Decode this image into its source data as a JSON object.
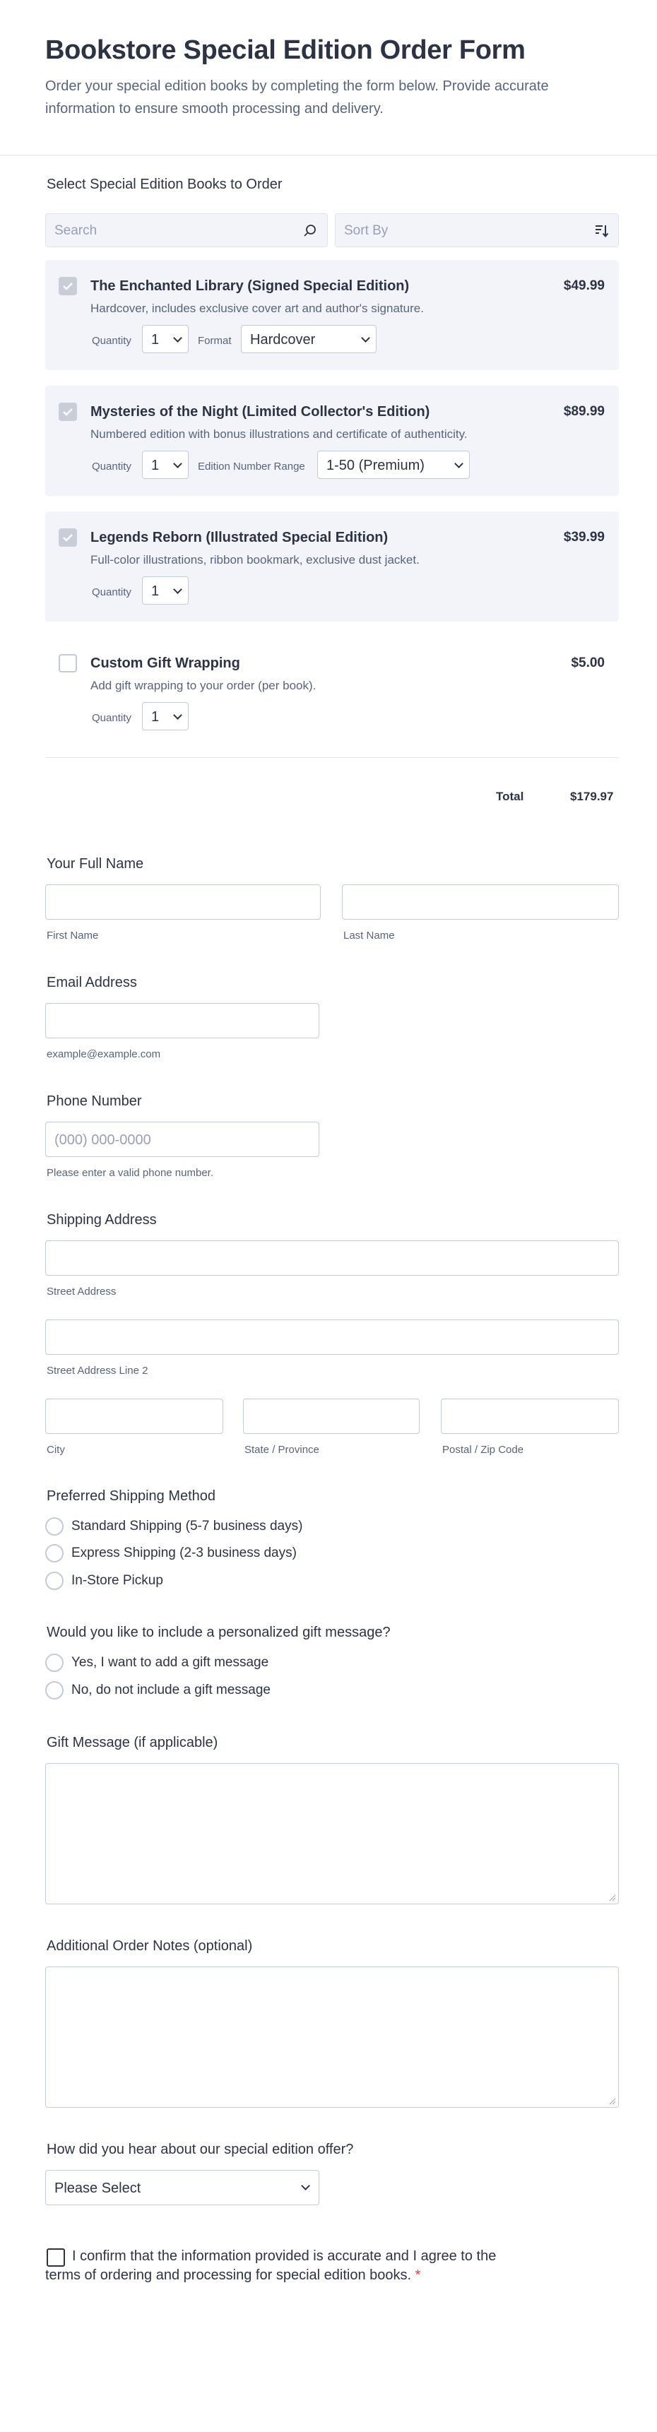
{
  "header": {
    "title": "Bookstore Special Edition Order Form",
    "subtitle": "Order your special edition books by completing the form below. Provide accurate information to ensure smooth processing and delivery."
  },
  "products": {
    "section_label": "Select Special Edition Books to Order",
    "search_placeholder": "Search",
    "sort_placeholder": "Sort By",
    "items": [
      {
        "name": "The Enchanted Library (Signed Special Edition)",
        "desc": "Hardcover, includes exclusive cover art and author's signature.",
        "price": "$49.99",
        "qty_label": "Quantity",
        "qty": "1",
        "opt_label": "Format",
        "opt_value": "Hardcover"
      },
      {
        "name": "Mysteries of the Night (Limited Collector's Edition)",
        "desc": "Numbered edition with bonus illustrations and certificate of authenticity.",
        "price": "$89.99",
        "qty_label": "Quantity",
        "qty": "1",
        "opt_label": "Edition Number Range",
        "opt_value": "1-50 (Premium)"
      },
      {
        "name": "Legends Reborn (Illustrated Special Edition)",
        "desc": "Full-color illustrations, ribbon bookmark, exclusive dust jacket.",
        "price": "$39.99",
        "qty_label": "Quantity",
        "qty": "1"
      },
      {
        "name": "Custom Gift Wrapping",
        "desc": "Add gift wrapping to your order (per book).",
        "price": "$5.00",
        "qty_label": "Quantity",
        "qty": "1"
      }
    ],
    "total_label": "Total",
    "total_value": "$179.97"
  },
  "name": {
    "label": "Your Full Name",
    "first": "First Name",
    "last": "Last Name"
  },
  "email": {
    "label": "Email Address",
    "sub": "example@example.com"
  },
  "phone": {
    "label": "Phone Number",
    "placeholder": "(000) 000-0000",
    "sub": "Please enter a valid phone number."
  },
  "address": {
    "label": "Shipping Address",
    "street": "Street Address",
    "street2": "Street Address Line 2",
    "city": "City",
    "state": "State / Province",
    "zip": "Postal / Zip Code"
  },
  "shipping": {
    "label": "Preferred Shipping Method",
    "options": [
      "Standard Shipping (5-7 business days)",
      "Express Shipping (2-3 business days)",
      "In-Store Pickup"
    ]
  },
  "gift_q": {
    "label": "Would you like to include a personalized gift message?",
    "options": [
      "Yes, I want to add a gift message",
      "No, do not include a gift message"
    ]
  },
  "gift_msg": {
    "label": "Gift Message (if applicable)"
  },
  "notes": {
    "label": "Additional Order Notes (optional)"
  },
  "referral": {
    "label": "How did you hear about our special edition offer?",
    "value": "Please Select"
  },
  "confirm": {
    "line1": "I confirm that the information provided is accurate and I agree to the",
    "line2": "terms of ordering and processing for special edition books.",
    "required_mark": "*",
    "required_color": "#f23a3c"
  }
}
